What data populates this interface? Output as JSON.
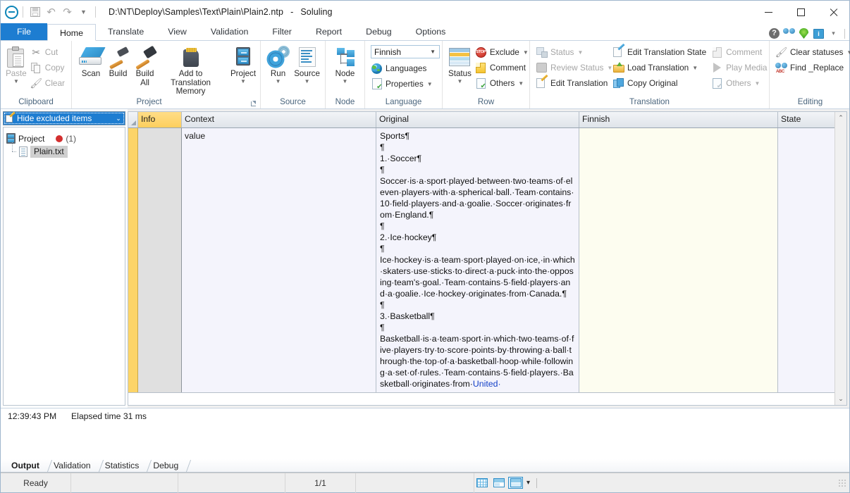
{
  "window": {
    "title_path": "D:\\NT\\Deploy\\Samples\\Text\\Plain\\Plain2.ntp",
    "title_dash": "-",
    "app_name": "Soluling",
    "minimize": "—",
    "maximize": "□",
    "close": "✕"
  },
  "quick_access": {
    "app_button": "app-menu",
    "save": "Save",
    "undo": "Undo",
    "redo": "Redo",
    "more": "Customize Quick Access Toolbar"
  },
  "help_icons": {
    "help": "?",
    "binoculars": "Search",
    "globe": "Web",
    "monitor": "Info",
    "more": "▾"
  },
  "tabs": [
    {
      "label": "File",
      "state": "file"
    },
    {
      "label": "Home",
      "state": "active"
    },
    {
      "label": "Translate",
      "state": "normal"
    },
    {
      "label": "View",
      "state": "normal"
    },
    {
      "label": "Validation",
      "state": "normal"
    },
    {
      "label": "Filter",
      "state": "normal"
    },
    {
      "label": "Report",
      "state": "normal"
    },
    {
      "label": "Debug",
      "state": "normal"
    },
    {
      "label": "Options",
      "state": "normal"
    }
  ],
  "ribbon": {
    "clipboard": {
      "group_label": "Clipboard",
      "paste": "Paste",
      "cut": "Cut",
      "copy": "Copy",
      "clear": "Clear"
    },
    "project": {
      "group_label": "Project",
      "scan": "Scan",
      "build": "Build",
      "build_all": "Build\nAll",
      "add_to_tm": "Add to Translation\nMemory",
      "project": "Project"
    },
    "source": {
      "group_label": "Source",
      "run": "Run",
      "source": "Source"
    },
    "node": {
      "group_label": "Node",
      "node": "Node"
    },
    "language": {
      "group_label": "Language",
      "selected_language": "Finnish",
      "languages": "Languages",
      "properties": "Properties"
    },
    "row": {
      "group_label": "Row",
      "status": "Status",
      "exclude": "Exclude",
      "comment": "Comment",
      "others": "Others"
    },
    "translation": {
      "group_label": "Translation",
      "status": "Status",
      "review_status": "Review Status",
      "edit_translation": "Edit Translation",
      "edit_translation_state": "Edit Translation State",
      "load_translation": "Load Translation",
      "copy_original": "Copy Original",
      "comment": "Comment",
      "play_media": "Play Media",
      "others": "Others"
    },
    "editing": {
      "group_label": "Editing",
      "clear_statuses": "Clear statuses",
      "find_replace": "Find _Replace"
    }
  },
  "left_pane": {
    "filter_label": "Hide excluded items",
    "tree": {
      "project_label": "Project",
      "project_count": "(1)",
      "file_label": "Plain.txt"
    }
  },
  "grid": {
    "columns": [
      "Info",
      "Context",
      "Original",
      "Finnish",
      "State"
    ],
    "row": {
      "context": "value",
      "original_lines": [
        {
          "text": "Sports¶"
        },
        {
          "text": "¶"
        },
        {
          "text": "1.·Soccer¶"
        },
        {
          "text": "¶"
        },
        {
          "text": "Soccer·is·a·sport·played·between·two·teams·of·eleven·players·with·a·spherical·ball.·Team·contains·10·field·players·and·a·goalie.·Soccer·originates·from·England.¶"
        },
        {
          "text": "¶"
        },
        {
          "text": "2.·Ice·hockey¶"
        },
        {
          "text": "¶"
        },
        {
          "text": "Ice·hockey·is·a·team·sport·played·on·ice,·in·which·skaters·use·sticks·to·direct·a·puck·into·the·opposing·team's·goal.·Team·contains·5·field·players·and·a·goalie.·Ice·hockey·originates·from·Canada.¶"
        },
        {
          "text": "¶"
        },
        {
          "text": "3.·Basketball¶"
        },
        {
          "text": "¶"
        },
        {
          "text": "Basketball·is·a·team·sport·in·which·two·teams·of·five·players·try·to·score·points·by·throwing·a·ball·through·the·top·of·a·basketball·hoop·while·following·a·set·of·rules.·Team·contains·5·field·players.·Basketball·originates·from·"
        }
      ],
      "original_tail_highlight": "United·",
      "finnish": "",
      "state": ""
    },
    "scroll_up": "⌃",
    "scroll_down": "⌄"
  },
  "output": {
    "timestamp": "12:39:43 PM",
    "message": "Elapsed time 31 ms",
    "tabs": [
      {
        "label": "Output",
        "active": true
      },
      {
        "label": "Validation",
        "active": false
      },
      {
        "label": "Statistics",
        "active": false
      },
      {
        "label": "Debug",
        "active": false
      }
    ]
  },
  "statusbar": {
    "ready": "Ready",
    "cell_b": "",
    "page_indicator": "1/1",
    "cell_d": "",
    "cell_e": "",
    "view_modes": [
      "grid-view",
      "split-view",
      "stacked-view"
    ],
    "selected_view_index": 2,
    "view_caret": "▾"
  },
  "colors": {
    "accent_blue": "#1d7dd1",
    "info_column": "#fdcf5d",
    "selected_row_marker": "#fcd468",
    "target_cell": "#fdfdf0",
    "source_cell": "#f4f4fc",
    "highlight_text": "#1340c8",
    "error_dot": "#d32f2f"
  }
}
